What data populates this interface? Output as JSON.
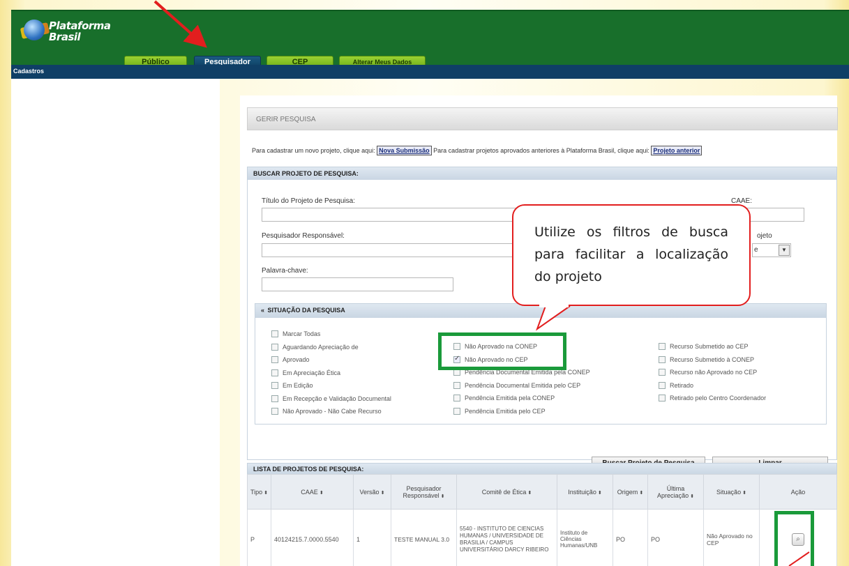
{
  "app": {
    "logo_line1": "Plataforma",
    "logo_line2": "Brasil"
  },
  "tabs": [
    {
      "label": "Público"
    },
    {
      "label": "Pesquisador"
    },
    {
      "label": "CEP"
    },
    {
      "label": "Alterar Meus Dados"
    }
  ],
  "subbar": {
    "label": "Cadastros"
  },
  "gerir": {
    "title": "GERIR PESQUISA"
  },
  "cadastro": {
    "text1": "Para cadastrar um novo projeto, clique aqui:",
    "btn_nova": "Nova Submissão",
    "text2": "Para cadastrar projetos aprovados anteriores à Plataforma Brasil, clique aqui:",
    "btn_anterior": "Projeto anterior"
  },
  "buscar": {
    "title": "BUSCAR PROJETO DE PESQUISA:",
    "titulo_label": "Título do Projeto de Pesquisa:",
    "caae_label": "CAAE:",
    "pesquisador_label": "Pesquisador Responsável:",
    "tipo_label": "ojeto",
    "tipo_value": "e",
    "palavra_label": "Palavra-chave:"
  },
  "situacao": {
    "title": "SITUAÇÃO DA PESQUISA",
    "col1": [
      {
        "label": "Marcar Todas",
        "checked": false
      },
      {
        "label": "Aguardando Apreciação de",
        "checked": false
      },
      {
        "label": "Aprovado",
        "checked": false
      },
      {
        "label": "Em Apreciação Ética",
        "checked": false
      },
      {
        "label": "Em Edição",
        "checked": false
      },
      {
        "label": "Em Recepção e Validação Documental",
        "checked": false
      },
      {
        "label": "Não Aprovado - Não Cabe Recurso",
        "checked": false
      }
    ],
    "col2": [
      {
        "label": "Não Aprovado na CONEP",
        "checked": false
      },
      {
        "label": "Não Aprovado no CEP",
        "checked": true
      },
      {
        "label": "Pendência Documental Emitida pela CONEP",
        "checked": false
      },
      {
        "label": "Pendência Documental Emitida pelo CEP",
        "checked": false
      },
      {
        "label": "Pendência Emitida pela CONEP",
        "checked": false
      },
      {
        "label": "Pendência Emitida pelo CEP",
        "checked": false
      }
    ],
    "col3": [
      {
        "label": "Recurso Submetido ao CEP",
        "checked": false
      },
      {
        "label": "Recurso Submetido à CONEP",
        "checked": false
      },
      {
        "label": "Recurso não Aprovado no CEP",
        "checked": false
      },
      {
        "label": "Retirado",
        "checked": false
      },
      {
        "label": "Retirado pelo Centro Coordenador",
        "checked": false
      }
    ]
  },
  "actions": {
    "buscar": "Buscar Projeto de Pesquisa",
    "limpar": "Limpar"
  },
  "lista": {
    "title": "LISTA DE PROJETOS DE PESQUISA:",
    "headers": [
      "Tipo",
      "CAAE",
      "Versão",
      "Pesquisador Responsável",
      "Comitê de Ética",
      "Instituição",
      "Origem",
      "Última Apreciação",
      "Situação",
      "Ação"
    ],
    "rows": [
      [
        "P",
        "40124215.7.0000.5540",
        "1",
        "TESTE MANUAL 3.0",
        "5540 - INSTITUTO DE CIENCIAS HUMANAS / UNIVERSIDADE DE BRASILIA / CAMPUS UNIVERSITÁRIO DARCY RIBEIRO",
        "Instituto de Ciências Humanas/UNB",
        "PO",
        "PO",
        "Não Aprovado no CEP"
      ]
    ]
  },
  "callout": {
    "text": "Utilize os filtros de busca para facilitar a localização do projeto"
  },
  "colors": {
    "header_green": "#186f2b",
    "tab_green": "#8cc42a",
    "tab_active": "#1b5a82",
    "subbar": "#0f3f66",
    "highlight_green": "#1a9a3a",
    "annotation_red": "#e21e1e"
  },
  "icons": {
    "view": "magnifier-icon",
    "sort": "sort-arrows-icon",
    "collapse": "double-chevron-left-icon",
    "dropdown": "dropdown-arrow-icon"
  }
}
